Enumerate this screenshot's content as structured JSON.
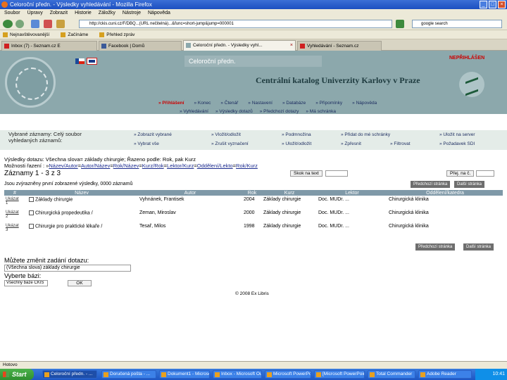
{
  "browser": {
    "title": "Celoroční předn. - Výsledky vyhledávání - Mozilla Firefox",
    "menu": [
      "Soubor",
      "Úpravy",
      "Zobrazit",
      "Historie",
      "Záložky",
      "Nástroje",
      "Nápověda"
    ],
    "url": "http://ckis.cuni.cz/F/DBQ...(URL nečitelná)...&func=short-jump&jump=000001",
    "search_text": "google search",
    "bookmarks": [
      "Nejnavštěvovanější",
      "Začínáme",
      "Přehled zpráv"
    ],
    "tabs": [
      {
        "label": "Inbox (7) - Seznam.cz E",
        "active": false
      },
      {
        "label": "Facebook | Domů",
        "active": false
      },
      {
        "label": "Celoroční předn. - Výsledky vyhl...",
        "active": true
      },
      {
        "label": "Vyhledávání - Seznam.cz",
        "active": false
      }
    ],
    "status": "Hotovo"
  },
  "header": {
    "band_title": "Celoroční předn.",
    "login_status": "NEPŘIHLÁŠEN",
    "catalog_title": "Centrální katalog Univerzity Karlovy v Praze"
  },
  "main_menu": [
    {
      "label": "» Přihlášení",
      "active": true
    },
    {
      "label": "» Konec",
      "active": false
    },
    {
      "label": "» Čtenář",
      "active": false
    },
    {
      "label": "» Nastavení",
      "active": false
    },
    {
      "label": "» Databáze",
      "active": false
    },
    {
      "label": "» Připomínky",
      "active": false
    },
    {
      "label": "» Nápověda",
      "active": false
    }
  ],
  "sub_menu": [
    "» Vyhledávání",
    "» Výsledky dotazů",
    "» Předchozí dotazy",
    "» Má schránka"
  ],
  "records_panel": {
    "label": "Vybrané záznamy: Celý soubor vyhledaných záznamů:",
    "links": [
      "» Zobrazit vybrané",
      "» Vložit/odložit",
      "» Podmnožina",
      "» Přidat do mé schránky",
      "» Uložit na server",
      "» Vybrat vše",
      "» Zrušit vyznačení",
      "» Uložit/odložit",
      "» Zpřesnit",
      "» Filtrovat",
      "» Požadavek SDI"
    ]
  },
  "results": {
    "query_line": "Výsledky dotazu: Všechna slova= základy chirurgie; Řazeno podle: Rok, pak Kurz",
    "sort_label": "Možnosti řazení : »",
    "sort_links": [
      "Název/Autor",
      "Autor/Název",
      "Rok/Název",
      "Kurz/Rok",
      "Lektor/Kurz",
      "Oddělení/Lekto",
      "Rok/Kurz"
    ],
    "records_count": "Záznamy 1 - 3 z 3",
    "jump_button": "Skok na text",
    "jump_to": "Přej. na č.",
    "prev_page": "Předchozí stránka",
    "next_page": "Další stránka",
    "hint": "Jsou zvýrazněny první zobrazené výsledky, 0000 záznamů",
    "columns": [
      "#",
      "Název",
      "Autor",
      "Rok",
      "Kurz",
      "Lektor",
      "Oddělení/katedra"
    ],
    "rows": [
      {
        "num": "1",
        "action": "Ukázat",
        "title": "Základy chirurgie",
        "author": "Vyhnánek, Frantisek",
        "year": "2004",
        "course": "Základy chirurgie",
        "lector": "Doc. MUDr. ...",
        "dept": "Chirurgická klinika"
      },
      {
        "num": "2",
        "action": "Ukázat",
        "title": "Chirurgická propedeutika /",
        "author": "Zeman, Miroslav",
        "year": "2000",
        "course": "Základy chirurgie",
        "lector": "Doc. MUDr. ...",
        "dept": "Chirurgická klinika"
      },
      {
        "num": "3",
        "action": "Ukázat",
        "title": "Chirurgie pro praktické lékaře /",
        "author": "Tesař, Milos",
        "year": "1998",
        "course": "Základy chirurgie",
        "lector": "Doc. MUDr. ...",
        "dept": "Chirurgická klinika"
      }
    ]
  },
  "change_query": {
    "title": "Můžete změnit zadání dotazu:",
    "query_value": "(Všechna slova) základy chirurgie",
    "select_label": "Vyberte bázi:",
    "base_value": "Všechny báze CKIS",
    "ok_button": "OK"
  },
  "footer": "© 2008 Ex Libris",
  "taskbar": {
    "start_label": "Start",
    "buttons": [
      "Celoroční předn. - ...",
      "Doručená pošta - ...",
      "Dokument1 - Microsoft...",
      "Inbox - Microsoft Outl...",
      "Microsoft PowerPoint",
      "[Microsoft PowerPoint...]",
      "Total Commander",
      "Adobe Reader"
    ],
    "clock": "10:41"
  },
  "colors": {
    "header_bg": "#8ca8ac",
    "table_header_bg": "#7f99a8",
    "link": "#1a2a8e",
    "accent_red": "#cc0000"
  }
}
